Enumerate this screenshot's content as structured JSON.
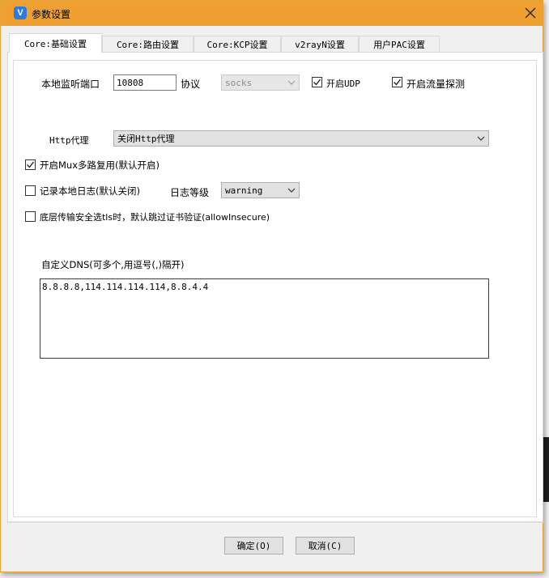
{
  "window": {
    "title": "参数设置",
    "app_icon_letter": "V",
    "close_glyph": "✕"
  },
  "tabs": [
    {
      "label": "Core:基础设置",
      "active": true
    },
    {
      "label": "Core:路由设置",
      "active": false
    },
    {
      "label": "Core:KCP设置",
      "active": false
    },
    {
      "label": "v2rayN设置",
      "active": false
    },
    {
      "label": "用户PAC设置",
      "active": false
    }
  ],
  "basic": {
    "local_port_label": "本地监听端口",
    "local_port_value": "10808",
    "protocol_label": "协议",
    "protocol_value": "socks",
    "udp_label": "开启UDP",
    "udp_checked": true,
    "sniffing_label": "开启流量探测",
    "sniffing_checked": true,
    "http_proxy_label": "Http代理",
    "http_proxy_value": "关闭Http代理",
    "mux_label": "开启Mux多路复用(默认开启)",
    "mux_checked": true,
    "log_label": "记录本地日志(默认关闭)",
    "log_checked": false,
    "log_level_label": "日志等级",
    "log_level_value": "warning",
    "allow_insecure_label": "底层传输安全选tls时，默认跳过证书验证(allowInsecure)",
    "allow_insecure_checked": false,
    "dns_label": "自定义DNS(可多个,用逗号(,)隔开)",
    "dns_value": "8.8.8.8,114.114.114.114,8.8.4.4"
  },
  "footer": {
    "ok_label": "确定(O)",
    "cancel_label": "取消(C)"
  },
  "colors": {
    "titlebar": "#f0a030",
    "app_icon": "#2d7be0"
  }
}
